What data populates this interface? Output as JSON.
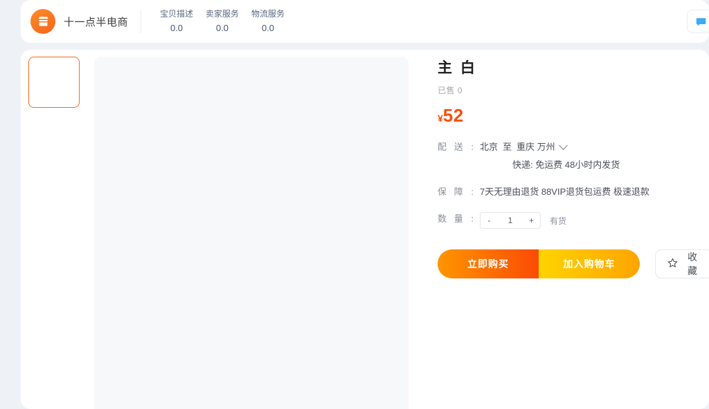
{
  "header": {
    "logo_icon": "shop-icon",
    "shop_name": "十一点半电商",
    "ratings": [
      {
        "label": "宝贝描述",
        "value": "0.0"
      },
      {
        "label": "卖家服务",
        "value": "0.0"
      },
      {
        "label": "物流服务",
        "value": "0.0"
      }
    ],
    "action_icon": "chat-icon"
  },
  "gallery": {
    "thumbnails": [
      {
        "name": "thumbnail-1",
        "selected": true
      }
    ]
  },
  "product": {
    "title": "主 白",
    "sold_label": "已售 0",
    "price_symbol": "¥",
    "price_value": "52",
    "shipping": {
      "label_a": "配",
      "label_b": "送",
      "colon": ":",
      "from": "北京",
      "separator": "至",
      "to": "重庆 万州",
      "chevron_icon": "chevron-down-icon",
      "sub": "快递: 免运费  48小时内发货"
    },
    "guarantee": {
      "label_a": "保",
      "label_b": "障",
      "colon": ":",
      "text": "7天无理由退货 88VIP退货包运费 极速退款"
    },
    "quantity": {
      "label_a": "数",
      "label_b": "量",
      "colon": ":",
      "decrease": "-",
      "value": "1",
      "increase": "+",
      "stock_text": "有货"
    }
  },
  "actions": {
    "buy_now": "立即购买",
    "add_to_cart": "加入购物车",
    "favorite": "收藏",
    "favorite_icon": "star-outline-icon"
  },
  "colors": {
    "page_bg": "#eef2f7",
    "accent_orange": "#fb4e08",
    "buy_gradient_from": "#ff9500",
    "buy_gradient_to": "#fb4b05",
    "cart_gradient_from": "#ffd400",
    "cart_gradient_to": "#ffa400",
    "thumb_selected_border": "#f56a20"
  }
}
